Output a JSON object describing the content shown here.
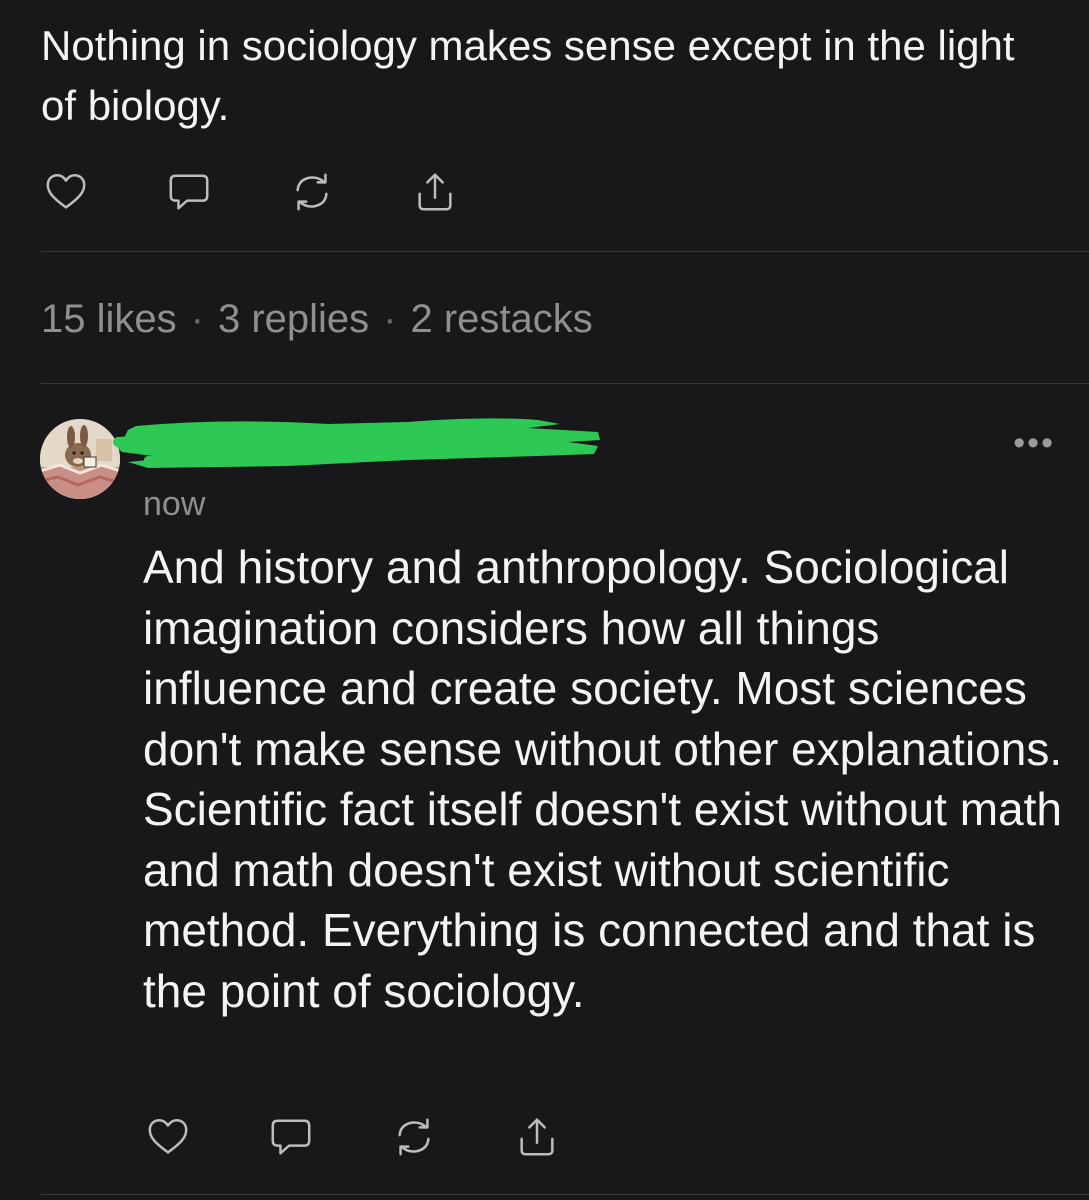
{
  "post": {
    "text": "Nothing in sociology makes sense except in the light of biology."
  },
  "stats": {
    "likes": "15 likes",
    "replies": "3 replies",
    "restacks": "2 restacks",
    "separator": "·"
  },
  "reply": {
    "timestamp": "now",
    "more_label": "•••",
    "text": "And history and anthropology. Sociological imagination considers how all things influence and create society. Most sciences don't make sense without other explanations. Scientific fact itself doesn't exist without math and math doesn't exist without scientific method. Everything is connected and that is the point of sociology."
  },
  "icons": {
    "like": "heart-icon",
    "comment": "comment-icon",
    "restack": "restack-icon",
    "share": "share-icon"
  },
  "colors": {
    "background": "#18181a",
    "text": "#f4f4f4",
    "muted": "#8e8e93",
    "redaction": "#2ec955"
  }
}
